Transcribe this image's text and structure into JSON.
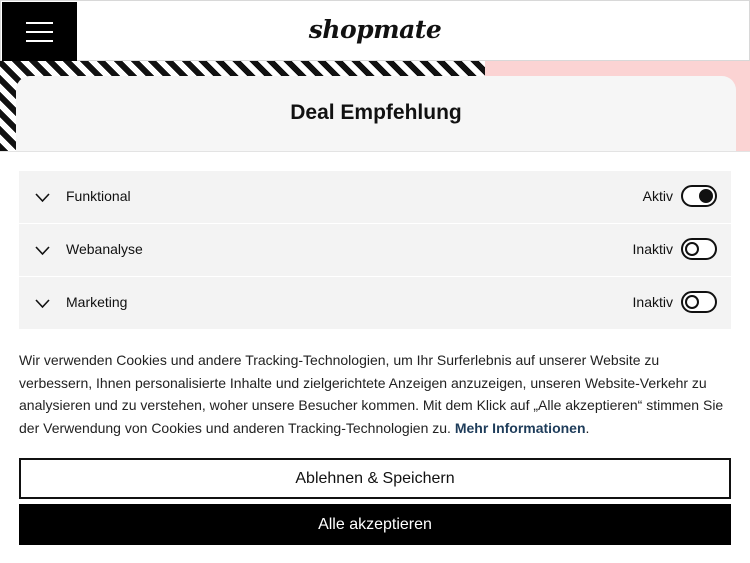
{
  "header": {
    "logo_text": "shopmate"
  },
  "hero": {
    "deal_title": "Deal Empfehlung"
  },
  "consent": {
    "categories": [
      {
        "label": "Funktional",
        "status": "Aktiv",
        "enabled": true
      },
      {
        "label": "Webanalyse",
        "status": "Inaktiv",
        "enabled": false
      },
      {
        "label": "Marketing",
        "status": "Inaktiv",
        "enabled": false
      }
    ],
    "info_text": "Wir verwenden Cookies und andere Tracking-Technologien, um Ihr Surferlebnis auf unserer Website zu verbessern, Ihnen personalisierte Inhalte und zielgerichtete Anzeigen anzuzeigen, unseren Website-Verkehr zu analysieren und zu verstehen, woher unsere Besucher kommen. Mit dem Klick auf „Alle akzeptieren“ stimmen Sie der Verwendung von Cookies und anderen Tracking-Technologien zu.",
    "more_info_link": "Mehr Informationen",
    "info_end": ".",
    "decline_label": "Ablehnen & Speichern",
    "accept_label": "Alle akzeptieren"
  },
  "colors": {
    "accent_dark": "#000000",
    "link": "#1e3c5a",
    "hero_pink": "#fbd3d3",
    "category_bg": "#f3f3f3"
  },
  "icons": [
    "hamburger-menu-icon",
    "chevron-down-icon"
  ]
}
